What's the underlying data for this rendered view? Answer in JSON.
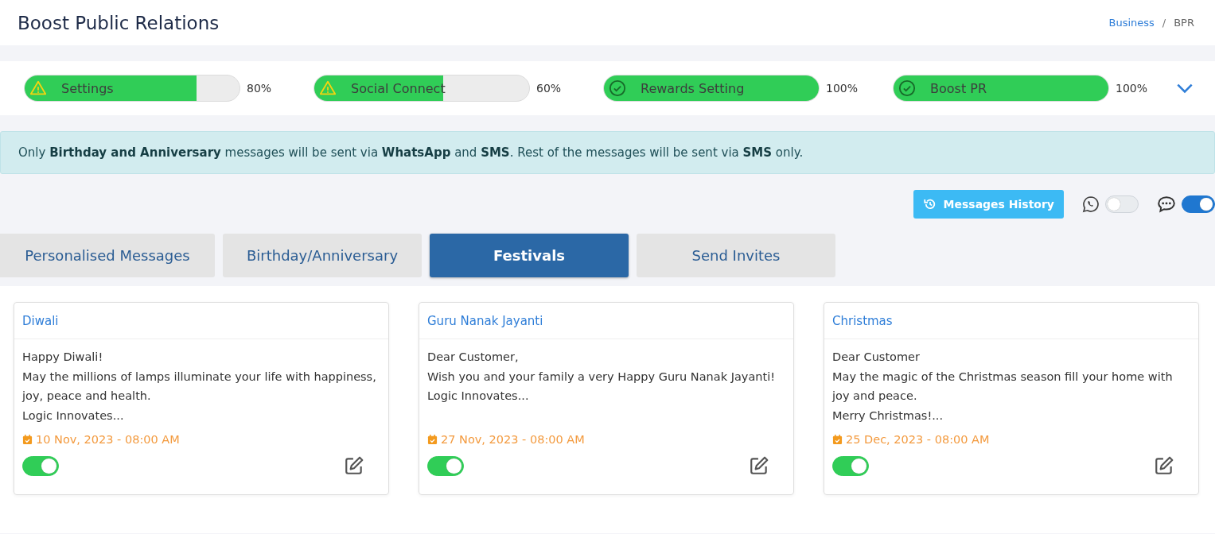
{
  "header": {
    "title": "Boost Public Relations",
    "breadcrumb": [
      {
        "label": "Business",
        "link": true
      },
      {
        "label": "BPR",
        "link": false
      }
    ],
    "separator": "/"
  },
  "progress": [
    {
      "label": "Settings",
      "kind": "warning",
      "level": 0.8,
      "reading": "80%"
    },
    {
      "label": "Social Connect",
      "kind": "warning",
      "level": 0.6,
      "reading": "60%"
    },
    {
      "label": "Rewards Setting",
      "kind": "done",
      "level": 1,
      "reading": "100%"
    },
    {
      "label": "Boost PR",
      "kind": "done",
      "level": 1,
      "reading": "100%"
    }
  ],
  "alert": "Only **Birthday and Anniversary** messages will be sent via **WhatsApp** and **SMS**. Rest of the messages will be sent via **SMS** only.",
  "toolbar": {
    "history_button": "Messages History",
    "channels": [
      {
        "kind": "whatsapp",
        "on": false
      },
      {
        "kind": "sms",
        "on": true
      }
    ]
  },
  "tabs": [
    {
      "label": "Personalised Messages",
      "selected": false
    },
    {
      "label": "Birthday/Anniversary",
      "selected": false
    },
    {
      "label": "Festivals",
      "selected": true
    },
    {
      "label": "Send Invites",
      "selected": false
    }
  ],
  "cards": [
    {
      "title": "Diwali",
      "message": "Happy Diwali!\nMay the millions of lamps illuminate your life with happiness, joy, peace and health.\nLogic Innovates...",
      "date": "10 Nov, 2023 - 08:00 AM",
      "on": true
    },
    {
      "title": "Guru Nanak Jayanti",
      "message": "Dear Customer,\nWish you and your family a very Happy Guru Nanak Jayanti!\nLogic Innovates...",
      "date": "27 Nov, 2023 - 08:00 AM",
      "on": true
    },
    {
      "title": "Christmas",
      "message": "Dear Customer\nMay the magic of the Christmas season fill your home with joy and peace.\nMerry Christmas!...",
      "date": "25 Dec, 2023 - 08:00 AM",
      "on": true
    }
  ]
}
